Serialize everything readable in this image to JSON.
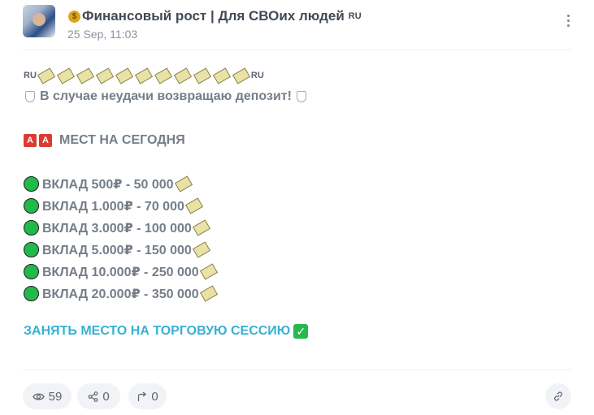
{
  "post": {
    "channel_title": "Финансовый рост | Для СВОих людей",
    "flag": "RU",
    "date": "25 Sep, 11:03"
  },
  "content": {
    "flag_left": "RU",
    "flag_right": "RU",
    "bill_count": 11,
    "warning_text": "В случае неудачи возвращаю депозит!",
    "seats_letters": [
      "A",
      "A"
    ],
    "seats_text": "МЕСТ НА СЕГОДНЯ",
    "deposits": [
      "ВКЛАД 500₽ - 50 000",
      "ВКЛАД 1.000₽ - 70 000",
      "ВКЛАД 3.000₽ - 100 000",
      "ВКЛАД 5.000₽ - 150 000",
      "ВКЛАД 10.000₽ - 250 000",
      "ВКЛАД 20.000₽ - 350 000"
    ],
    "cta": "ЗАНЯТЬ МЕСТО НА ТОРГОВУЮ СЕССИЮ"
  },
  "stats": {
    "views": "59",
    "shares": "0",
    "forwards": "0"
  },
  "icons": {
    "menu": "more-vertical-icon",
    "views": "eye-icon",
    "shares": "share-icon",
    "forwards": "forward-icon",
    "link": "link-icon"
  },
  "colors": {
    "cta": "#38b0d4",
    "dot": "#21b94a",
    "check": "#29b84e",
    "red_box": "#dc3b2f"
  }
}
